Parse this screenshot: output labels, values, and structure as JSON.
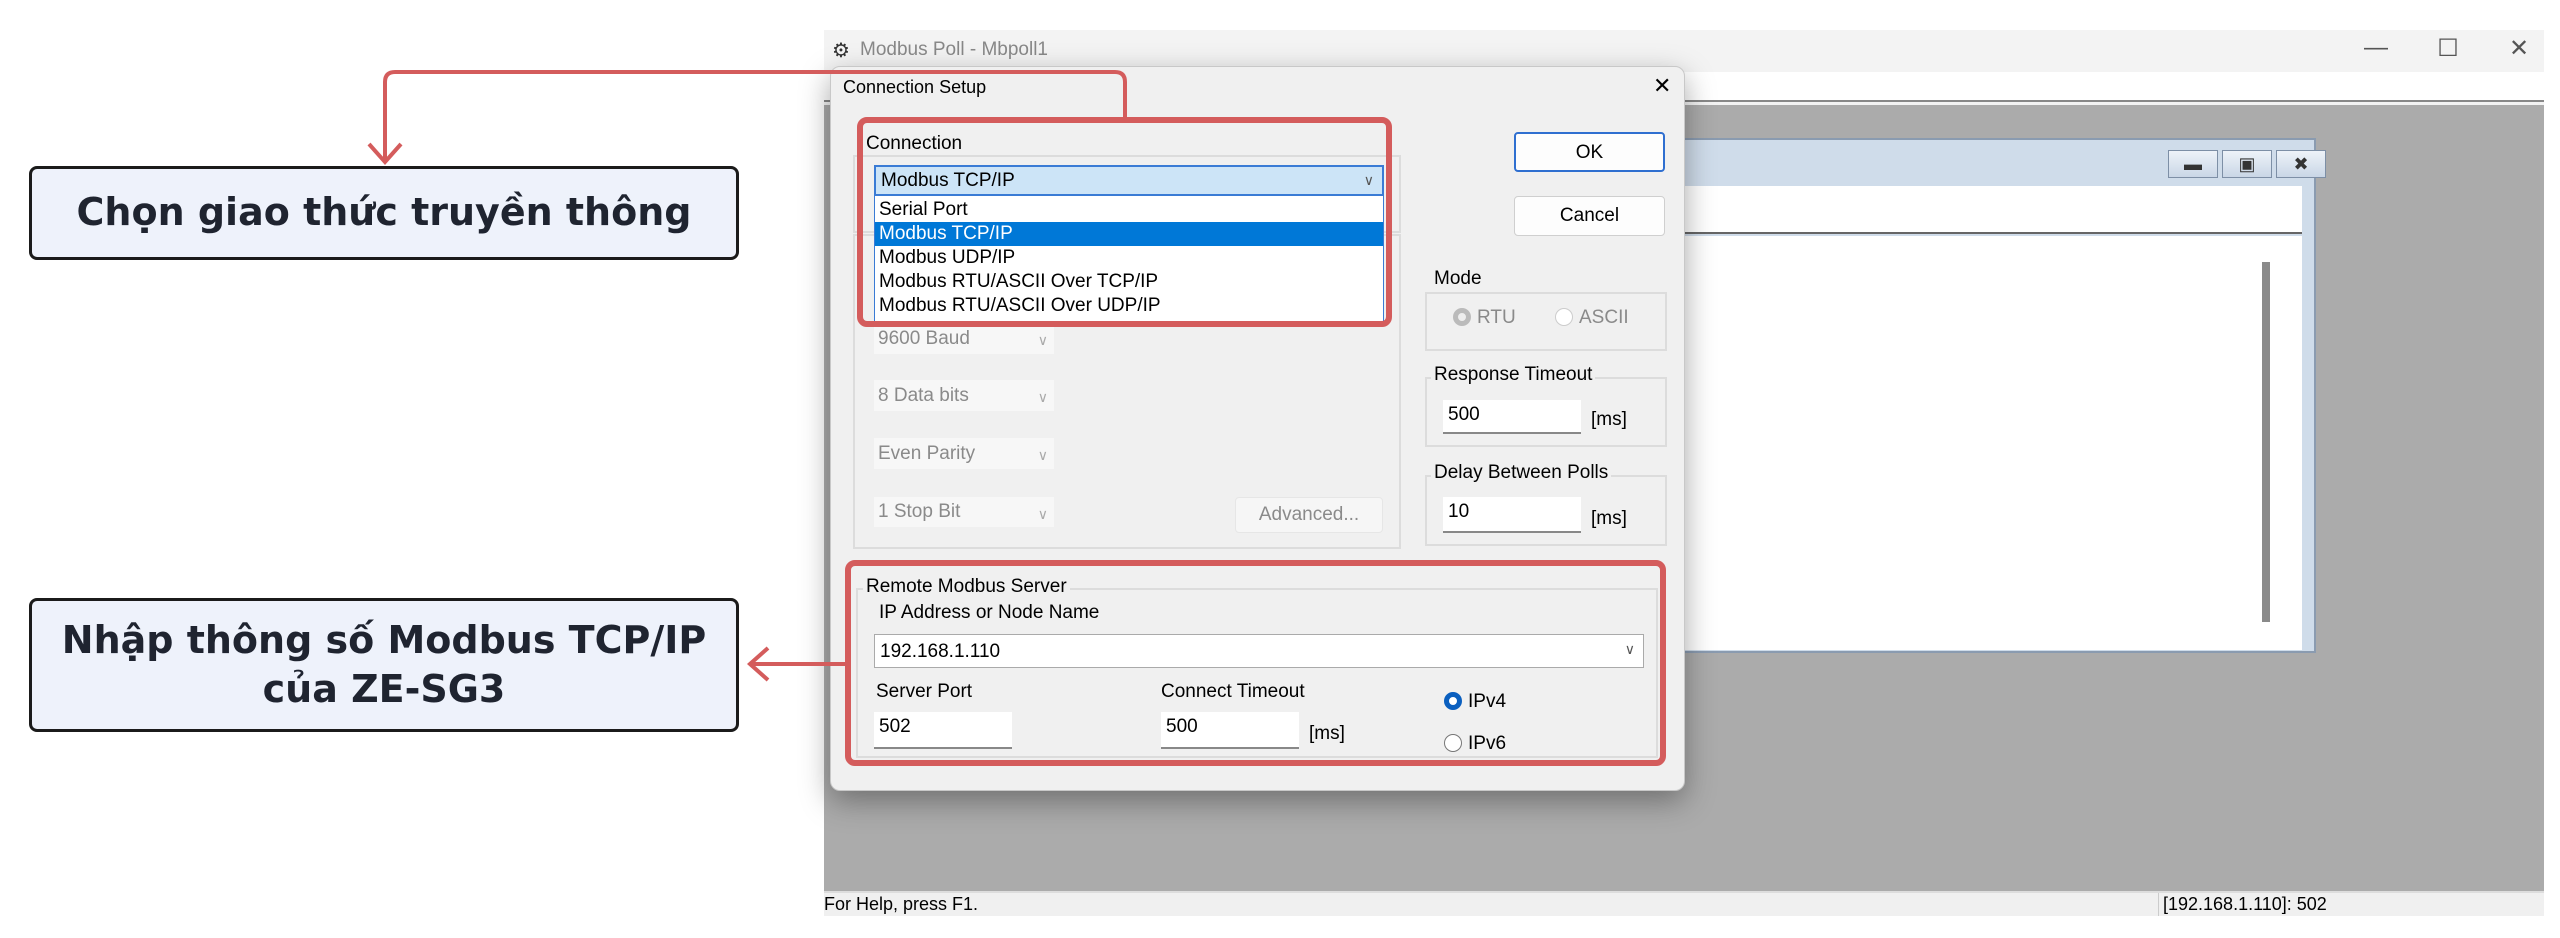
{
  "annotations": {
    "choose_protocol": "Chọn giao thức truyền thông",
    "enter_params_line1": "Nhập thông số Modbus TCP/IP",
    "enter_params_line2": "của ZE-SG3",
    "highlight_color": "#d45c5c"
  },
  "app": {
    "title": "Modbus Poll - Mbpoll1",
    "status_help": "For Help, press F1.",
    "status_connection": "[192.168.1.110]: 502"
  },
  "dialog": {
    "title": "Connection Setup",
    "ok": "OK",
    "cancel": "Cancel",
    "connection": {
      "label": "Connection",
      "selected": "Modbus TCP/IP",
      "options": [
        "Serial Port",
        "Modbus TCP/IP",
        "Modbus UDP/IP",
        "Modbus RTU/ASCII Over TCP/IP",
        "Modbus RTU/ASCII Over UDP/IP"
      ],
      "highlighted_index": 1
    },
    "serial": {
      "baud": "9600 Baud",
      "data_bits": "8 Data bits",
      "parity": "Even Parity",
      "stop_bits": "1 Stop Bit",
      "advanced": "Advanced..."
    },
    "mode": {
      "label": "Mode",
      "rtu": "RTU",
      "ascii": "ASCII",
      "selected": "RTU"
    },
    "response_timeout": {
      "label": "Response Timeout",
      "value": "500",
      "unit": "[ms]"
    },
    "delay_between_polls": {
      "label": "Delay Between Polls",
      "value": "10",
      "unit": "[ms]"
    },
    "remote": {
      "label": "Remote Modbus Server",
      "ip_label": "IP Address or Node Name",
      "ip_value": "192.168.1.110",
      "port_label": "Server Port",
      "port_value": "502",
      "timeout_label": "Connect Timeout",
      "timeout_value": "500",
      "timeout_unit": "[ms]",
      "ipv4": "IPv4",
      "ipv6": "IPv6",
      "selected": "IPv4"
    }
  }
}
